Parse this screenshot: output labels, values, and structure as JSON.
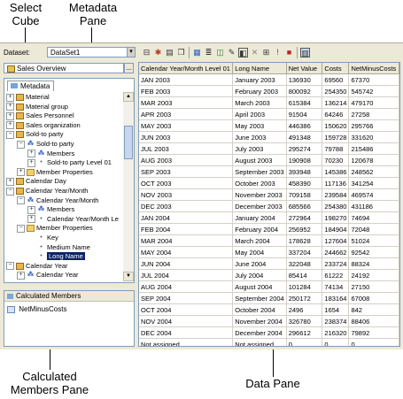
{
  "callouts": {
    "select_cube": [
      "Select",
      "Cube"
    ],
    "metadata_pane": [
      "Metadata",
      "Pane"
    ],
    "calculated_members_pane": [
      "Calculated",
      "Members Pane"
    ],
    "data_pane": "Data Pane"
  },
  "toolbar": {
    "dataset_label": "Dataset:",
    "dataset_value": "DataSet1",
    "dropdown_glyph": "▾",
    "icons": [
      "filter-icon",
      "refresh-icon",
      "export-icon",
      "copy-icon",
      "layout-icon",
      "sort-icon",
      "pivot-icon",
      "show-empty-icon",
      "delete-icon",
      "import-icon",
      "cancel-icon",
      "auto-execute-icon"
    ]
  },
  "cube": {
    "value": "Sales Overview",
    "browse_label": "..."
  },
  "metadata": {
    "tab_label": "Metadata",
    "tree": [
      {
        "label": "Material",
        "indent": 0,
        "expander": "+",
        "icon": "cube"
      },
      {
        "label": "Material group",
        "indent": 0,
        "expander": "+",
        "icon": "cube"
      },
      {
        "label": "Sales Personnel",
        "indent": 0,
        "expander": "+",
        "icon": "cube"
      },
      {
        "label": "Sales organization",
        "indent": 0,
        "expander": "+",
        "icon": "cube"
      },
      {
        "label": "Sold-to party",
        "indent": 0,
        "expander": "−",
        "icon": "cube"
      },
      {
        "label": "Sold-to party",
        "indent": 1,
        "expander": "−",
        "icon": "hier"
      },
      {
        "label": "Members",
        "indent": 2,
        "expander": "+",
        "icon": "hier"
      },
      {
        "label": "Sold-to party Level 01",
        "indent": 2,
        "expander": "+",
        "icon": "attr"
      },
      {
        "label": "Member Properties",
        "indent": 1,
        "expander": "+",
        "icon": "folder"
      },
      {
        "label": "Calendar Day",
        "indent": 0,
        "expander": "+",
        "icon": "cube"
      },
      {
        "label": "Calendar Year/Month",
        "indent": 0,
        "expander": "−",
        "icon": "cube"
      },
      {
        "label": "Calendar Year/Month",
        "indent": 1,
        "expander": "−",
        "icon": "hier"
      },
      {
        "label": "Members",
        "indent": 2,
        "expander": "+",
        "icon": "hier"
      },
      {
        "label": "Calendar Year/Month Le",
        "indent": 2,
        "expander": "+",
        "icon": "attr"
      },
      {
        "label": "Member Properties",
        "indent": 1,
        "expander": "−",
        "icon": "folder"
      },
      {
        "label": "Key",
        "indent": 2,
        "expander": "",
        "icon": "attr"
      },
      {
        "label": "Medium Name",
        "indent": 2,
        "expander": "",
        "icon": "attr"
      },
      {
        "label": "Long Name",
        "indent": 2,
        "expander": "",
        "icon": "attr",
        "selected": true
      },
      {
        "label": "Calendar Year",
        "indent": 0,
        "expander": "−",
        "icon": "cube"
      },
      {
        "label": "Calendar Year",
        "indent": 1,
        "expander": "+",
        "icon": "hier"
      }
    ]
  },
  "calculated": {
    "header": "Calculated Members",
    "items": [
      "NetMinusCosts"
    ]
  },
  "grid": {
    "columns": [
      "Calendar Year/Month Level 01",
      "Long Name",
      "Net Value",
      "Costs",
      "NetMinusCosts"
    ],
    "rows": [
      [
        "JAN 2003",
        "January 2003",
        "136930",
        "69560",
        "67370"
      ],
      [
        "FEB 2003",
        "February 2003",
        "800092",
        "254350",
        "545742"
      ],
      [
        "MAR 2003",
        "March 2003",
        "615384",
        "136214",
        "479170"
      ],
      [
        "APR 2003",
        "April 2003",
        "91504",
        "64246",
        "27258"
      ],
      [
        "MAY 2003",
        "May 2003",
        "446386",
        "150620",
        "295766"
      ],
      [
        "JUN 2003",
        "June 2003",
        "491348",
        "159728",
        "331620"
      ],
      [
        "JUL 2003",
        "July 2003",
        "295274",
        "79788",
        "215486"
      ],
      [
        "AUG 2003",
        "August 2003",
        "190908",
        "70230",
        "120678"
      ],
      [
        "SEP 2003",
        "September 2003",
        "393948",
        "145386",
        "248562"
      ],
      [
        "OCT 2003",
        "October 2003",
        "458390",
        "117136",
        "341254"
      ],
      [
        "NOV 2003",
        "November 2003",
        "709158",
        "239584",
        "469574"
      ],
      [
        "DEC 2003",
        "December 2003",
        "685566",
        "254380",
        "431186"
      ],
      [
        "JAN 2004",
        "January 2004",
        "272964",
        "198270",
        "74694"
      ],
      [
        "FEB 2004",
        "February 2004",
        "256952",
        "184904",
        "72048"
      ],
      [
        "MAR 2004",
        "March 2004",
        "178628",
        "127604",
        "51024"
      ],
      [
        "MAY 2004",
        "May 2004",
        "337204",
        "244662",
        "92542"
      ],
      [
        "JUN 2004",
        "June 2004",
        "322048",
        "233724",
        "88324"
      ],
      [
        "JUL 2004",
        "July 2004",
        "85414",
        "61222",
        "24192"
      ],
      [
        "AUG 2004",
        "August 2004",
        "101284",
        "74134",
        "27150"
      ],
      [
        "SEP 2004",
        "September 2004",
        "250172",
        "183164",
        "67008"
      ],
      [
        "OCT 2004",
        "October 2004",
        "2496",
        "1654",
        "842"
      ],
      [
        "NOV 2004",
        "November 2004",
        "326780",
        "238374",
        "88406"
      ],
      [
        "DEC 2004",
        "December 2004",
        "296612",
        "216320",
        "79892"
      ],
      [
        "Not assigned",
        "Not assigned",
        "0",
        "0",
        "0"
      ]
    ]
  }
}
